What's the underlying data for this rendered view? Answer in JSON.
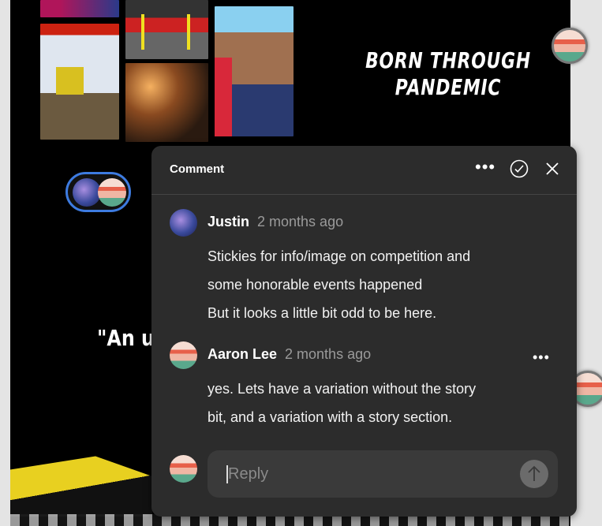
{
  "canvas": {
    "title": "BORN THROUGH PANDEMIC",
    "title_lines": [
      "BORN THROUGH",
      "PANDEMIC"
    ],
    "quote": "\"An up"
  },
  "comment_panel": {
    "header": "Comment",
    "icons": [
      "more-icon",
      "resolve-check-icon",
      "close-icon"
    ],
    "comments": [
      {
        "author": "Justin",
        "time": "2 months ago",
        "lines": [
          "Stickies for info/image on competition and",
          "some honorable events happened",
          "But it looks a little bit odd to be here."
        ]
      },
      {
        "author": "Aaron Lee",
        "time": "2 months ago",
        "lines": [
          "yes. Lets have a variation without the story",
          "bit, and a variation with a story section."
        ]
      }
    ],
    "reply": {
      "placeholder": "Reply",
      "value": ""
    }
  },
  "colors": {
    "panel": "#2c2c2c",
    "accent": "#3d7be0"
  }
}
